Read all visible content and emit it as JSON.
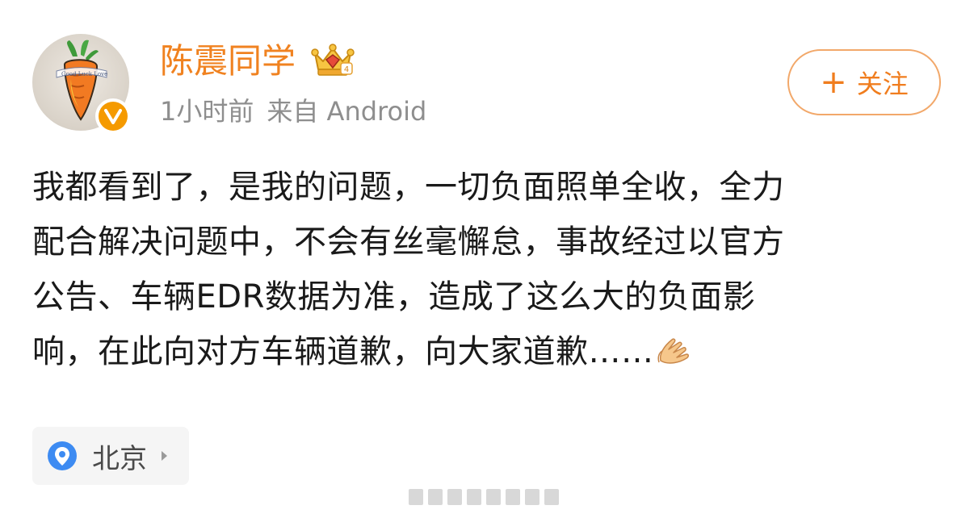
{
  "user": {
    "name": "陈震同学",
    "avatar_icon": "carrot-avatar-icon",
    "verified_icon": "verified-v-badge-icon",
    "crown_icon": "crown-badge-icon"
  },
  "meta": {
    "time": "1小时前",
    "source": "来自 Android"
  },
  "follow_button": {
    "plus": "+",
    "label": "关注"
  },
  "post": {
    "lines": [
      "我都看到了，是我的问题，一切负面照单全收，全力",
      "配合解决问题中，不会有丝毫懈怠，事故经过以官方",
      "公告、车辆EDR数据为准，造成了这么大的负面影",
      "响，在此向对方车辆道歉，向大家道歉……"
    ],
    "trailing_emoji": "praying-hands-emoji"
  },
  "location": {
    "label": "北京",
    "icon": "location-pin-icon"
  },
  "colors": {
    "accent": "#f08220",
    "follow_border": "#f2a86a",
    "meta_text": "#8e8e8e",
    "body_text": "#1a1a1a",
    "chip_bg": "#f5f5f5",
    "pin_blue": "#3d8bf2"
  }
}
